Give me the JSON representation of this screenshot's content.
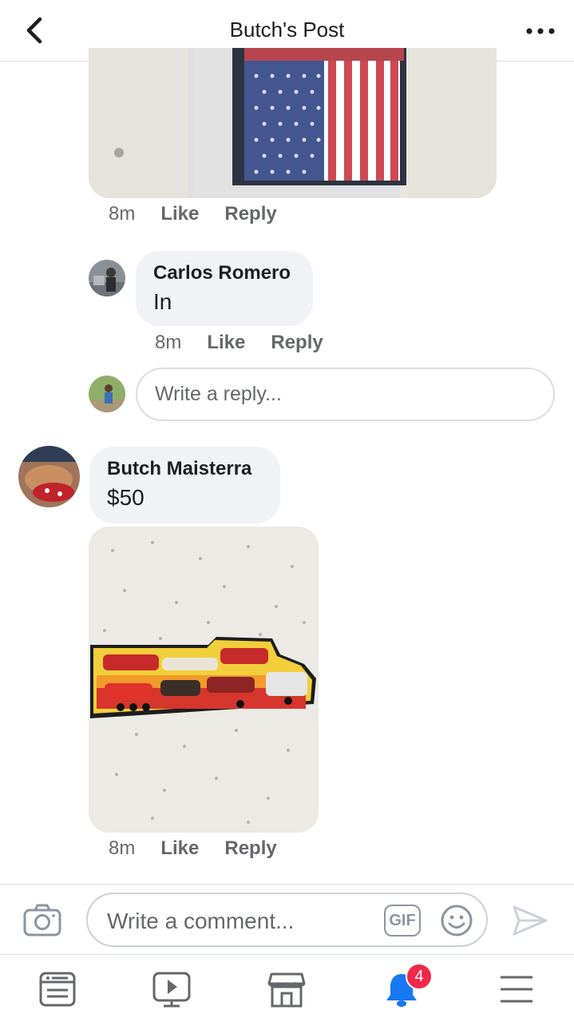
{
  "header": {
    "title": "Butch's Post"
  },
  "comments": [
    {
      "time": "8m",
      "like": "Like",
      "reply": "Reply"
    },
    {
      "author": "Carlos Romero",
      "text": "In",
      "time": "8m",
      "like": "Like",
      "reply": "Reply"
    },
    {
      "author": "Butch Maisterra",
      "text": "$50",
      "time": "8m",
      "like": "Like",
      "reply": "Reply"
    }
  ],
  "reply_input": {
    "placeholder": "Write a reply..."
  },
  "composer": {
    "placeholder": "Write a comment...",
    "gif_label": "GIF"
  },
  "bottom_nav": {
    "items": [
      "news-feed-icon",
      "watch-icon",
      "marketplace-icon",
      "notifications-icon",
      "menu-icon"
    ],
    "notification_count": "4"
  },
  "colors": {
    "accent": "#1877f2",
    "badge": "#f02849",
    "muted": "#65676b"
  }
}
